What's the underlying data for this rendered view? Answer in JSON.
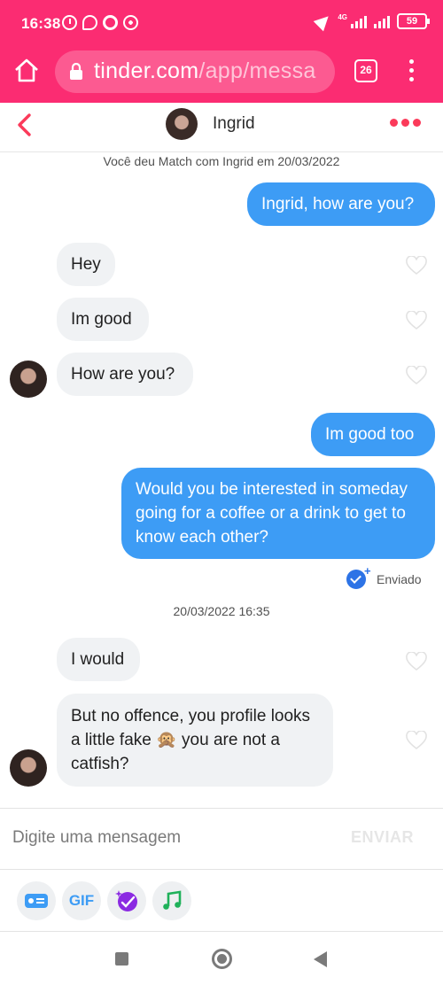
{
  "status_bar": {
    "time": "16:38",
    "network": "4G",
    "battery": "59"
  },
  "browser": {
    "url_host": "tinder.com",
    "url_path": "/app/messa",
    "tab_count": "26"
  },
  "chat_header": {
    "name": "Ingrid"
  },
  "match_notice": "Você deu Match com Ingrid em 20/03/2022",
  "messages": [
    {
      "dir": "out",
      "text": "Ingrid, how are you?"
    },
    {
      "dir": "in",
      "text": "Hey"
    },
    {
      "dir": "in",
      "text": "Im good"
    },
    {
      "dir": "in",
      "text": "How are you?"
    },
    {
      "dir": "out",
      "text": "Im good too"
    },
    {
      "dir": "out",
      "text": "Would you be interested in someday going for a coffee or a drink to get to know each other?"
    },
    {
      "dir": "in",
      "text": "I would"
    },
    {
      "dir": "in",
      "text": "But no offence, you profile looks a little fake 🙊 you are not a catfish?"
    }
  ],
  "sent_status": "Enviado",
  "timestamp": "20/03/2022 16:35",
  "composer": {
    "placeholder": "Digite uma mensagem",
    "send_label": "ENVIAR"
  },
  "tools": {
    "gif_label": "GIF"
  },
  "colors": {
    "brand_pink": "#fb2c72",
    "bubble_out": "#3d9cf5",
    "bubble_in": "#f0f2f4",
    "accent_red": "#fb3a5a"
  }
}
